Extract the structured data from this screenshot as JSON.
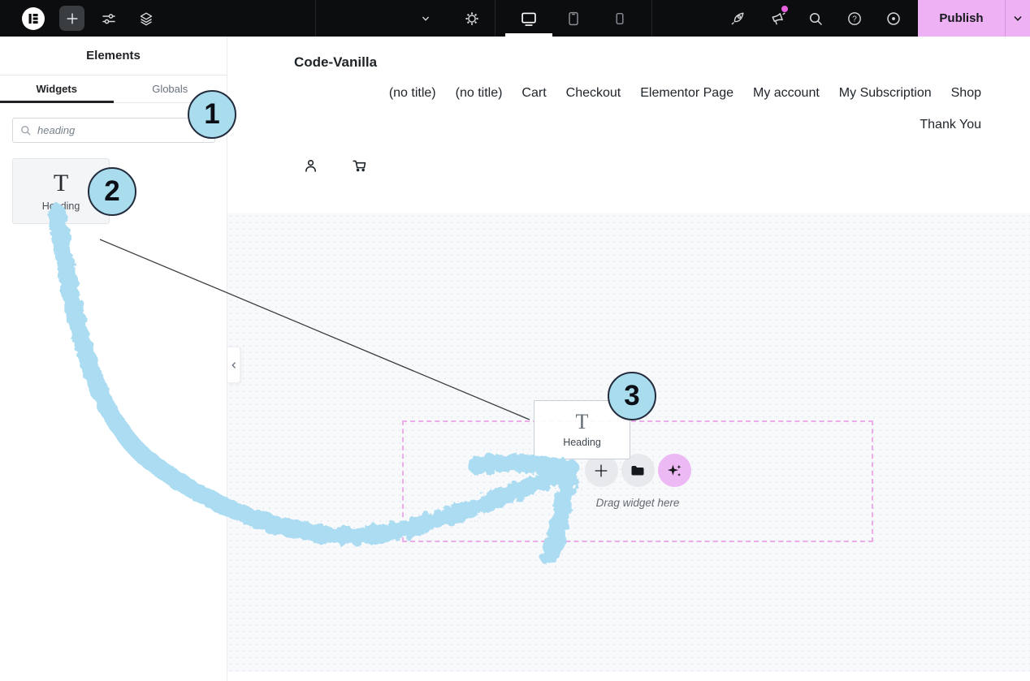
{
  "topbar": {
    "publish_label": "Publish",
    "help_glyph": "?",
    "icons": [
      "elementor-logo",
      "add-element",
      "site-settings-sliders",
      "structure-layers",
      "document-chevron-down",
      "page-settings-gear",
      "desktop-preview",
      "tablet-preview",
      "mobile-preview",
      "whats-new-rocket",
      "notifications-megaphone",
      "finder-search",
      "help-question",
      "preview-eye",
      "publish-chevron-down"
    ]
  },
  "panel": {
    "title": "Elements",
    "tabs": [
      {
        "label": "Widgets",
        "active": true
      },
      {
        "label": "Globals",
        "active": false
      }
    ],
    "search_value": "heading",
    "widget_card": {
      "glyph": "T",
      "label": "Heading"
    }
  },
  "canvas": {
    "site_title": "Code-Vanilla",
    "menu_row1": [
      "(no title)",
      "(no title)",
      "Cart",
      "Checkout",
      "Elementor Page",
      "My account",
      "My Subscription",
      "Shop"
    ],
    "menu_row2": [
      "Thank You"
    ],
    "ghost_widget": {
      "glyph": "T",
      "label": "Heading"
    },
    "dropzone_hint": "Drag widget here"
  },
  "annotations": {
    "steps": [
      {
        "label": "1"
      },
      {
        "label": "2"
      },
      {
        "label": "3"
      }
    ]
  },
  "colors": {
    "topbar_bg": "#0c0d0e",
    "publish_pink": "#eeb2f4",
    "notification_dot": "#e85fe0",
    "dropzone_border": "#ecabe9",
    "ai_button_bg": "#edb9f5",
    "annotation_fill": "#a9ddee",
    "annotation_border": "#222c3d",
    "arrow_blue": "#abdcf2",
    "canvas_bg": "#f8f9fb"
  }
}
